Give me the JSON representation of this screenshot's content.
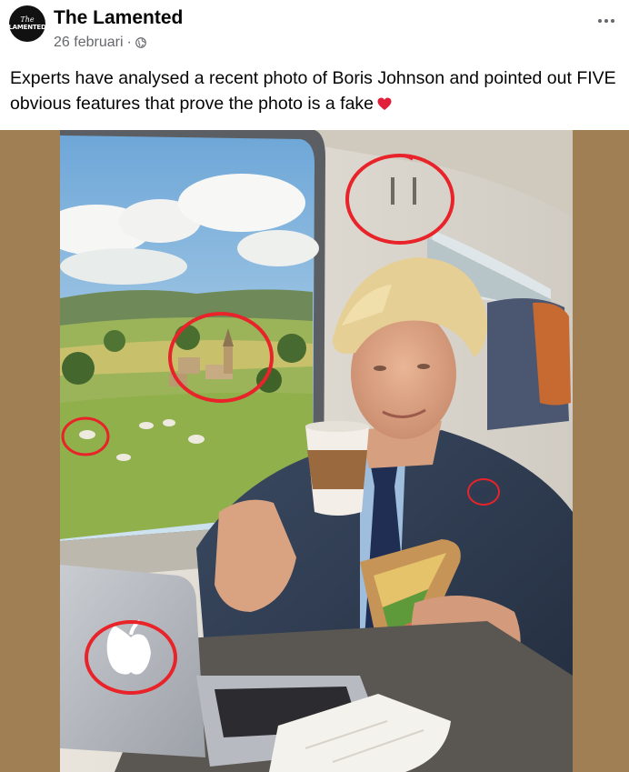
{
  "post": {
    "page_name": "The Lamented",
    "date": "26 februari",
    "separator": "·",
    "privacy_icon": "globe-icon",
    "more_icon": "more-options-icon",
    "avatar": {
      "top_text": "The",
      "main_text": "LAMENTED"
    },
    "caption": "Experts have analysed a recent photo of Boris Johnson and pointed out FIVE obvious features that prove the photo is a fake",
    "caption_emoji_icon": "red-heart-icon"
  },
  "colors": {
    "annotation_red": "#e8232a",
    "photo_background": "#a17f55",
    "secondary_text": "#65676b"
  }
}
